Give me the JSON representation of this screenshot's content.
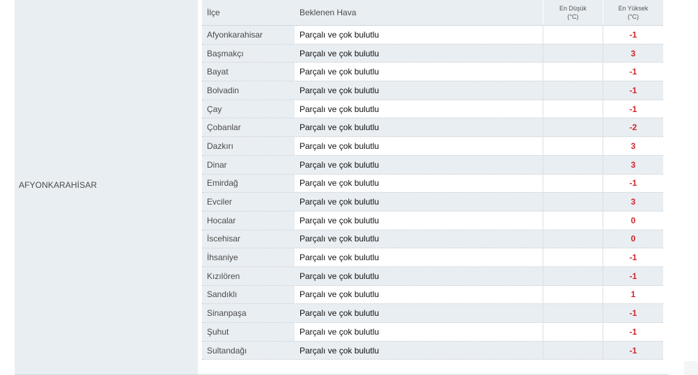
{
  "province": "AFYONKARAHİSAR",
  "headers": {
    "district": "İlçe",
    "weather": "Beklenen Hava",
    "min_line1": "En Düşük",
    "min_line2": "(°C)",
    "max_line1": "En Yüksek",
    "max_line2": "(°C)"
  },
  "rows": [
    {
      "district": "Afyonkarahisar",
      "weather": "Parçalı ve çok bulutlu",
      "min": "",
      "max": "-1"
    },
    {
      "district": "Başmakçı",
      "weather": "Parçalı ve çok bulutlu",
      "min": "",
      "max": "3"
    },
    {
      "district": "Bayat",
      "weather": "Parçalı ve çok bulutlu",
      "min": "",
      "max": "-1"
    },
    {
      "district": "Bolvadin",
      "weather": "Parçalı ve çok bulutlu",
      "min": "",
      "max": "-1"
    },
    {
      "district": "Çay",
      "weather": "Parçalı ve çok bulutlu",
      "min": "",
      "max": "-1"
    },
    {
      "district": "Çobanlar",
      "weather": "Parçalı ve çok bulutlu",
      "min": "",
      "max": "-2"
    },
    {
      "district": "Dazkırı",
      "weather": "Parçalı ve çok bulutlu",
      "min": "",
      "max": "3"
    },
    {
      "district": "Dinar",
      "weather": "Parçalı ve çok bulutlu",
      "min": "",
      "max": "3"
    },
    {
      "district": "Emirdağ",
      "weather": "Parçalı ve çok bulutlu",
      "min": "",
      "max": "-1"
    },
    {
      "district": "Evciler",
      "weather": "Parçalı ve çok bulutlu",
      "min": "",
      "max": "3"
    },
    {
      "district": "Hocalar",
      "weather": "Parçalı ve çok bulutlu",
      "min": "",
      "max": "0"
    },
    {
      "district": "İscehisar",
      "weather": "Parçalı ve çok bulutlu",
      "min": "",
      "max": "0"
    },
    {
      "district": "İhsaniye",
      "weather": "Parçalı ve çok bulutlu",
      "min": "",
      "max": "-1"
    },
    {
      "district": "Kızılören",
      "weather": "Parçalı ve çok bulutlu",
      "min": "",
      "max": "-1"
    },
    {
      "district": "Sandıklı",
      "weather": "Parçalı ve çok bulutlu",
      "min": "",
      "max": "1"
    },
    {
      "district": "Sinanpaşa",
      "weather": "Parçalı ve çok bulutlu",
      "min": "",
      "max": "-1"
    },
    {
      "district": "Şuhut",
      "weather": "Parçalı ve çok bulutlu",
      "min": "",
      "max": "-1"
    },
    {
      "district": "Sultandağı",
      "weather": "Parçalı ve çok bulutlu",
      "min": "",
      "max": "-1"
    }
  ],
  "colors": {
    "max_temp": "#d0242b",
    "panel_bg": "#e9eef2"
  }
}
